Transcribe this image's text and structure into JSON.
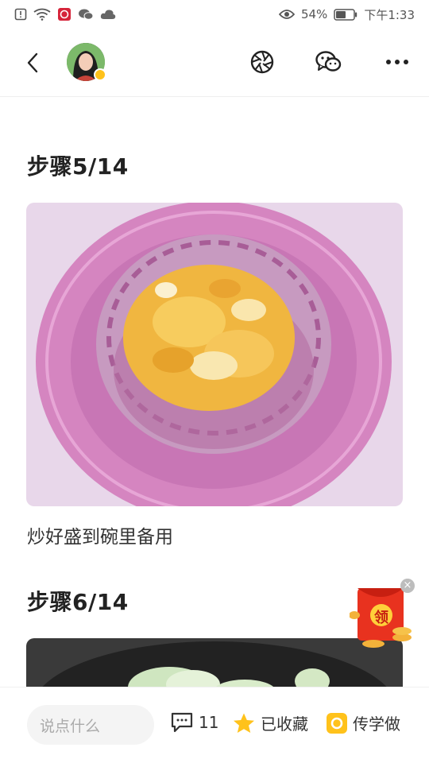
{
  "status_bar": {
    "battery_percent": "54%",
    "time": "下午1:33",
    "icons": [
      "alert-icon",
      "wifi-icon",
      "app-notification-icon",
      "wechat-icon",
      "cloud-icon",
      "eye-icon",
      "battery-icon"
    ]
  },
  "nav": {
    "icons": [
      "back-icon",
      "camera-shutter-icon",
      "wechat-share-icon",
      "more-icon"
    ]
  },
  "steps": [
    {
      "title": "步骤5/14",
      "description": "炒好盛到碗里备用"
    },
    {
      "title": "步骤6/14",
      "description": ""
    }
  ],
  "red_packet": {
    "label": "领"
  },
  "bottom_bar": {
    "comment_placeholder": "说点什么",
    "comment_count": "11",
    "collected_label": "已收藏",
    "upload_label": "传学做"
  },
  "colors": {
    "accent_yellow": "#ffc21b",
    "plate_pink": "#d889c6",
    "egg_yellow": "#f2b63a",
    "red_packet": "#e8321f"
  }
}
